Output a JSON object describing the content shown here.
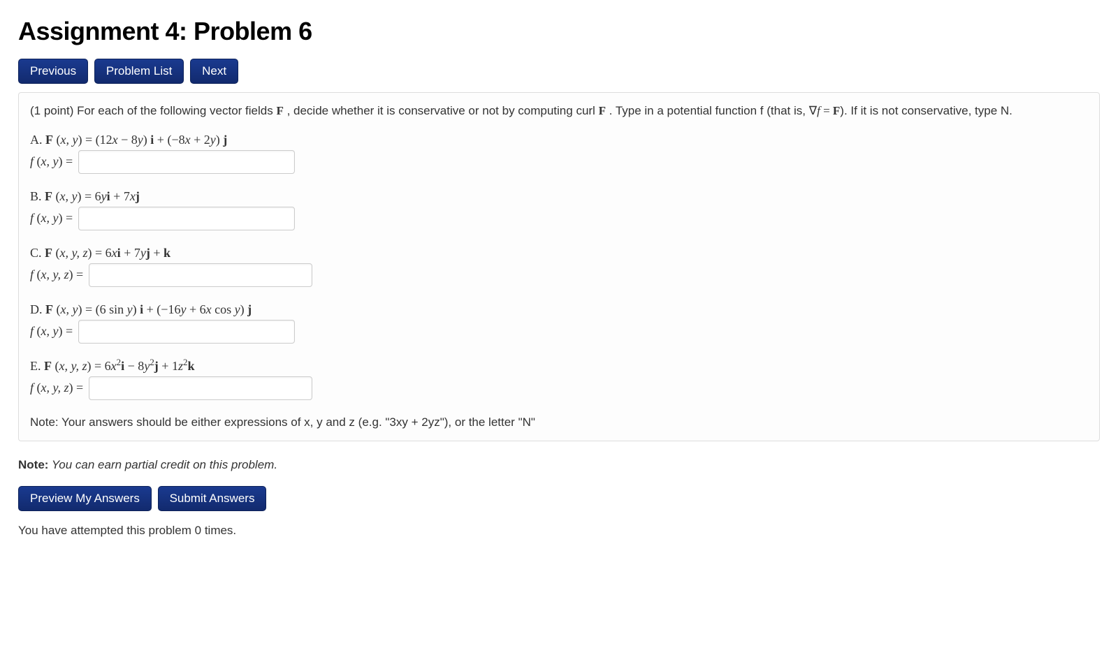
{
  "title": "Assignment 4: Problem 6",
  "nav": {
    "previous": "Previous",
    "problemList": "Problem List",
    "next": "Next"
  },
  "intro": {
    "pointPrefix": "(1 point) For each of the following vector fields ",
    "F": "F",
    "mid1": " , decide whether it is conservative or not by computing curl ",
    "mid2": " . Type in a potential function f (that is, ",
    "grad": "∇f = F",
    "tail": "). If it is not conservative, type N."
  },
  "parts": {
    "A": {
      "label": "A.",
      "lhsVars": "x, y",
      "rhs": "(12x − 8y) i + (−8x + 2y) j",
      "ansVars": "x, y"
    },
    "B": {
      "label": "B.",
      "lhsVars": "x, y",
      "rhs": "6yi + 7xj",
      "ansVars": "x, y"
    },
    "C": {
      "label": "C.",
      "lhsVars": "x, y, z",
      "rhs": "6xi + 7yj + k",
      "ansVars": "x, y, z"
    },
    "D": {
      "label": "D.",
      "lhsVars": "x, y",
      "rhs": "(6 sin y) i + (−16y + 6x cos y) j",
      "ansVars": "x, y"
    },
    "E": {
      "label": "E.",
      "lhsVars": "x, y, z",
      "rhs": "6x²i − 8y²j + 1z²k",
      "ansVars": "x, y, z"
    }
  },
  "noteInBox": "Note: Your answers should be either expressions of x, y and z (e.g. \"3xy + 2yz\"), or the letter \"N\"",
  "creditNote": {
    "bold": "Note:",
    "italic": " You can earn partial credit on this problem."
  },
  "actions": {
    "preview": "Preview My Answers",
    "submit": "Submit Answers"
  },
  "attempt": "You have attempted this problem 0 times."
}
